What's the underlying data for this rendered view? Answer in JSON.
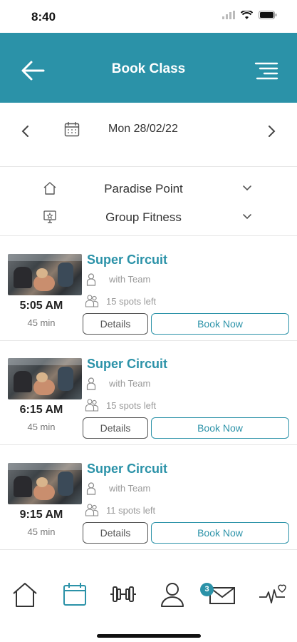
{
  "status": {
    "time": "8:40"
  },
  "header": {
    "title": "Book Class"
  },
  "date_nav": {
    "date": "Mon 28/02/22"
  },
  "filters": [
    {
      "label": "Paradise Point",
      "icon": "home-outline-icon"
    },
    {
      "label": "Group Fitness",
      "icon": "screen-star-icon"
    }
  ],
  "classes": [
    {
      "name": "Super Circuit",
      "instructor": "with Team",
      "spots": "15 spots left",
      "time": "5:05 AM",
      "duration": "45 min",
      "details_label": "Details",
      "book_label": "Book Now"
    },
    {
      "name": "Super Circuit",
      "instructor": "with Team",
      "spots": "15 spots left",
      "time": "6:15 AM",
      "duration": "45 min",
      "details_label": "Details",
      "book_label": "Book Now"
    },
    {
      "name": "Super Circuit",
      "instructor": "with Team",
      "spots": "11 spots left",
      "time": "9:15 AM",
      "duration": "45 min",
      "details_label": "Details",
      "book_label": "Book Now"
    }
  ],
  "tab_bar": {
    "active_tab": "calendar",
    "messages_badge": "3",
    "accent_color": "#2b92a8"
  }
}
